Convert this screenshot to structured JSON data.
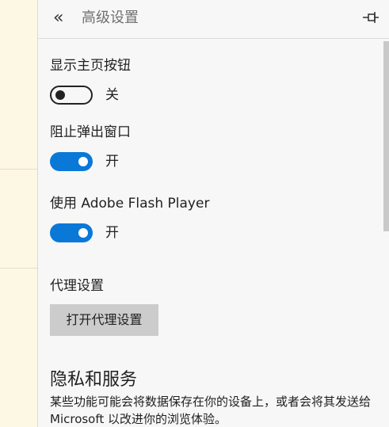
{
  "header": {
    "back_icon": "double-chevron-left-icon",
    "title": "高级设置",
    "pin_icon": "pin-icon"
  },
  "settings": {
    "home_button": {
      "label": "显示主页按钮",
      "state": "关",
      "on": false
    },
    "popup_block": {
      "label": "阻止弹出窗口",
      "state": "开",
      "on": true
    },
    "flash": {
      "label": "使用 Adobe Flash Player",
      "state": "开",
      "on": true
    },
    "proxy": {
      "label": "代理设置",
      "button_label": "打开代理设置"
    }
  },
  "privacy": {
    "heading": "隐私和服务",
    "description": "某些功能可能会将数据保存在你的设备上，或者会将其发送给 Microsoft 以改进你的浏览体验。"
  },
  "colors": {
    "toggle_on": "#0a78d7",
    "panel_bg": "#f7f7f7",
    "side_bg": "#fdf8e4"
  }
}
